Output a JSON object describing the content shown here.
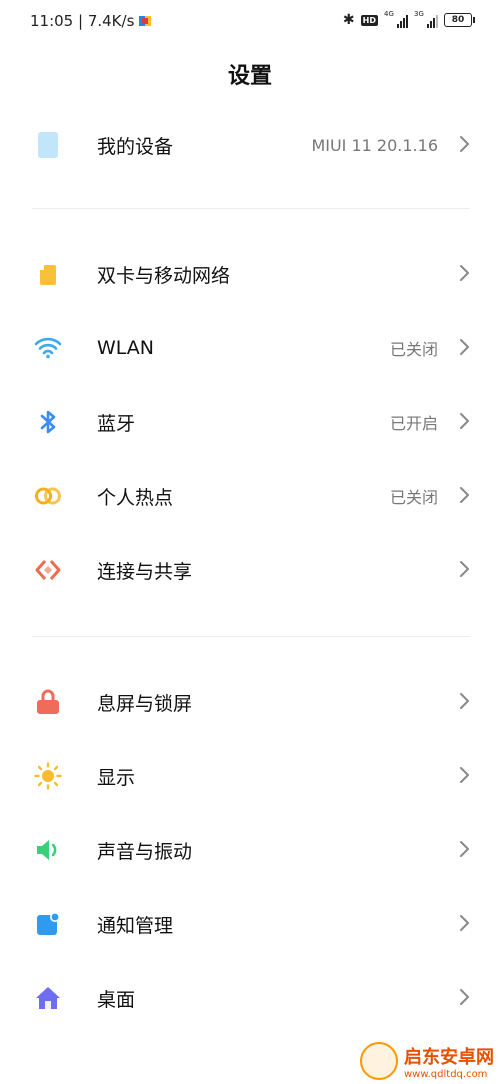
{
  "status_bar": {
    "time_speed": "11:05 | 7.4K/s",
    "net1": "4G",
    "net2": "3G",
    "battery": "80"
  },
  "title": "设置",
  "groups": [
    [
      {
        "name": "my-device",
        "icon": "tablet-icon",
        "color": "#4fb6f0",
        "label": "我的设备",
        "value": "MIUI 11 20.1.16"
      }
    ],
    [
      {
        "name": "dual-sim",
        "icon": "sim-card-icon",
        "color": "#f7c13a",
        "label": "双卡与移动网络",
        "value": ""
      },
      {
        "name": "wlan",
        "icon": "wifi-icon",
        "color": "#3aa8f2",
        "label": "WLAN",
        "value": "已关闭"
      },
      {
        "name": "bluetooth",
        "icon": "bluetooth-icon",
        "color": "#3a8ef0",
        "label": "蓝牙",
        "value": "已开启"
      },
      {
        "name": "hotspot",
        "icon": "hotspot-icon",
        "color": "#f2b11c",
        "label": "个人热点",
        "value": "已关闭"
      },
      {
        "name": "connection-sharing",
        "icon": "share-icon",
        "color": "#f06a4e",
        "label": "连接与共享",
        "value": ""
      }
    ],
    [
      {
        "name": "lock-screen",
        "icon": "lock-icon",
        "color": "#f06c5a",
        "label": "息屏与锁屏",
        "value": ""
      },
      {
        "name": "display",
        "icon": "sun-icon",
        "color": "#f7bd2e",
        "label": "显示",
        "value": ""
      },
      {
        "name": "sound-vibration",
        "icon": "speaker-icon",
        "color": "#3ccf7a",
        "label": "声音与振动",
        "value": ""
      },
      {
        "name": "notifications",
        "icon": "notification-icon",
        "color": "#2e9bf0",
        "label": "通知管理",
        "value": ""
      },
      {
        "name": "home-screen",
        "icon": "home-icon",
        "color": "#6f6ef0",
        "label": "桌面",
        "value": ""
      }
    ]
  ],
  "watermark": {
    "title": "启东安卓网",
    "url": "www.qdltdq.com"
  }
}
